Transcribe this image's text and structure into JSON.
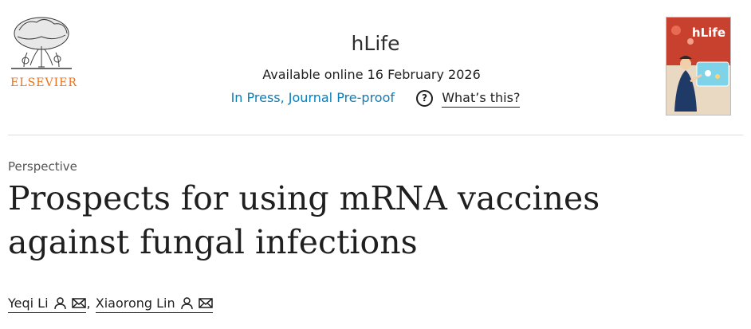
{
  "header": {
    "publisher": "ELSEVIER",
    "journal_title": "hLife",
    "available_online": "Available online 16 February 2026",
    "status_link": "In Press, Journal Pre-proof",
    "whats_this": "What’s this?",
    "cover_brand": "hLife"
  },
  "article": {
    "type": "Perspective",
    "title": "Prospects for using mRNA vaccines against fungal infections",
    "authors": [
      {
        "name": "Yeqi Li"
      },
      {
        "name": "Xiaorong Lin"
      }
    ],
    "author_separator": ","
  },
  "colors": {
    "elsevier_orange": "#e9711c",
    "link_blue": "#0c7dbb",
    "text": "#1f1f1f",
    "divider": "#dcdcdc"
  },
  "icons": [
    "elsevier-tree-logo",
    "question-icon",
    "person-icon",
    "mail-icon"
  ]
}
